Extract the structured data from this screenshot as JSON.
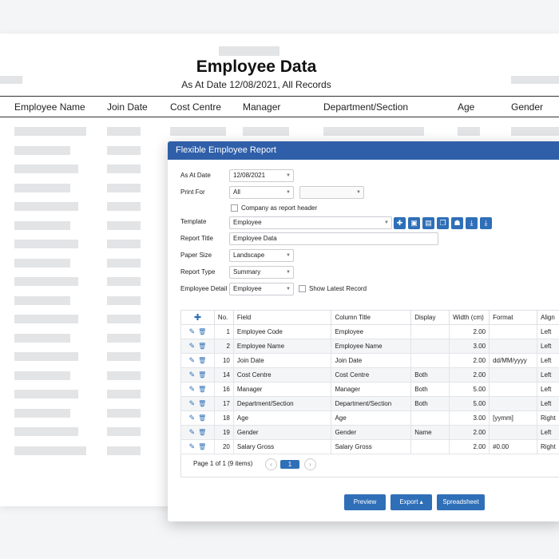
{
  "report": {
    "title": "Employee Data",
    "subtitle": "As At Date 12/08/2021, All Records",
    "columns": [
      "Employee Name",
      "Join Date",
      "Cost Centre",
      "Manager",
      "Department/Section",
      "Age",
      "Gender"
    ]
  },
  "dialog": {
    "title": "Flexible Employee Report",
    "fields": {
      "as_at_date": {
        "label": "As At Date",
        "value": "12/08/2021"
      },
      "print_for": {
        "label": "Print For",
        "value": "All",
        "secondary_value": ""
      },
      "company_header": {
        "label": "Company as report header",
        "checked": false
      },
      "template": {
        "label": "Template",
        "value": "Employee"
      },
      "report_title": {
        "label": "Report Title",
        "value": "Employee Data"
      },
      "paper_size": {
        "label": "Paper Size",
        "value": "Landscape"
      },
      "report_type": {
        "label": "Report Type",
        "value": "Summary"
      },
      "employee_detail": {
        "label": "Employee Detail",
        "value": "Employee"
      },
      "show_latest": {
        "label": "Show Latest Record",
        "checked": false
      }
    },
    "template_tools": [
      "add-icon",
      "save-icon",
      "delete-icon",
      "copy-icon",
      "share-icon",
      "import-icon",
      "export-icon"
    ],
    "grid": {
      "add_symbol": "✚",
      "headers": [
        "No.",
        "Field",
        "Column Title",
        "Display",
        "Width (cm)",
        "Format",
        "Align"
      ],
      "rows": [
        {
          "no": "1",
          "field": "Employee Code",
          "title": "Employee",
          "display": "",
          "width": "2.00",
          "format": "",
          "align": "Left"
        },
        {
          "no": "2",
          "field": "Employee Name",
          "title": "Employee Name",
          "display": "",
          "width": "3.00",
          "format": "",
          "align": "Left"
        },
        {
          "no": "10",
          "field": "Join Date",
          "title": "Join Date",
          "display": "",
          "width": "2.00",
          "format": "dd/MM/yyyy",
          "align": "Left"
        },
        {
          "no": "14",
          "field": "Cost Centre",
          "title": "Cost Centre",
          "display": "Both",
          "width": "2.00",
          "format": "",
          "align": "Left"
        },
        {
          "no": "16",
          "field": "Manager",
          "title": "Manager",
          "display": "Both",
          "width": "5.00",
          "format": "",
          "align": "Left"
        },
        {
          "no": "17",
          "field": "Department/Section",
          "title": "Department/Section",
          "display": "Both",
          "width": "5.00",
          "format": "",
          "align": "Left"
        },
        {
          "no": "18",
          "field": "Age",
          "title": "Age",
          "display": "",
          "width": "3.00",
          "format": "[yymm]",
          "align": "Right"
        },
        {
          "no": "19",
          "field": "Gender",
          "title": "Gender",
          "display": "Name",
          "width": "2.00",
          "format": "",
          "align": "Left"
        },
        {
          "no": "20",
          "field": "Salary Gross",
          "title": "Salary Gross",
          "display": "",
          "width": "2.00",
          "format": "#0.00",
          "align": "Right"
        }
      ]
    },
    "pager": {
      "summary": "Page 1 of 1 (9 items)",
      "current": "1",
      "prev": "‹",
      "next": "›"
    },
    "buttons": {
      "preview": "Preview",
      "export": "Export ▴",
      "spreadsheet": "Spreadsheet"
    }
  },
  "colors": {
    "accent": "#2f6fb8",
    "header": "#2f5fa8",
    "placeholder": "#e3e4e6"
  }
}
